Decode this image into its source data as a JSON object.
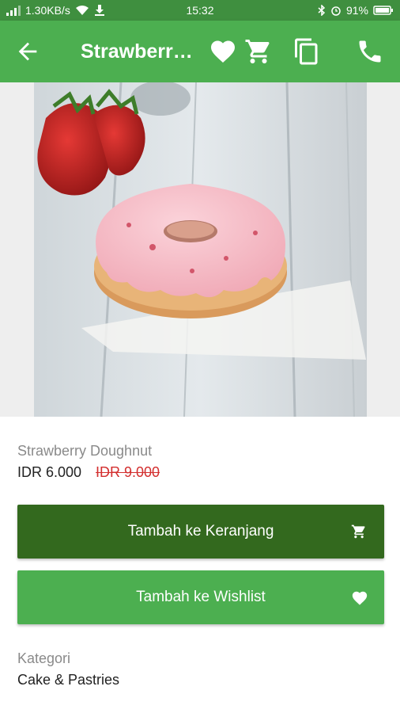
{
  "status_bar": {
    "network_speed": "1.30KB/s",
    "time": "15:32",
    "battery": "91%",
    "icons": [
      "signal-icon",
      "wifi-icon",
      "download-icon",
      "bluetooth-icon",
      "alarm-icon",
      "battery-icon"
    ]
  },
  "app_bar": {
    "title": "Strawberry Doughnut",
    "icons": [
      "back-arrow-icon",
      "heart-icon",
      "cart-icon",
      "copy-icon",
      "phone-icon"
    ],
    "color": "#4caf50"
  },
  "product": {
    "name": "Strawberry Doughnut",
    "price": "IDR 6.000",
    "original_price": "IDR 9.000"
  },
  "actions": {
    "add_to_cart": "Tambah ke Keranjang",
    "add_to_wishlist": "Tambah ke Wishlist"
  },
  "category": {
    "label": "Kategori",
    "value": "Cake & Pastries"
  },
  "colors": {
    "primary": "#4caf50",
    "primary_dark": "#33691e",
    "status_bar": "#3f8f3f",
    "strike_price": "#d32f2f"
  }
}
